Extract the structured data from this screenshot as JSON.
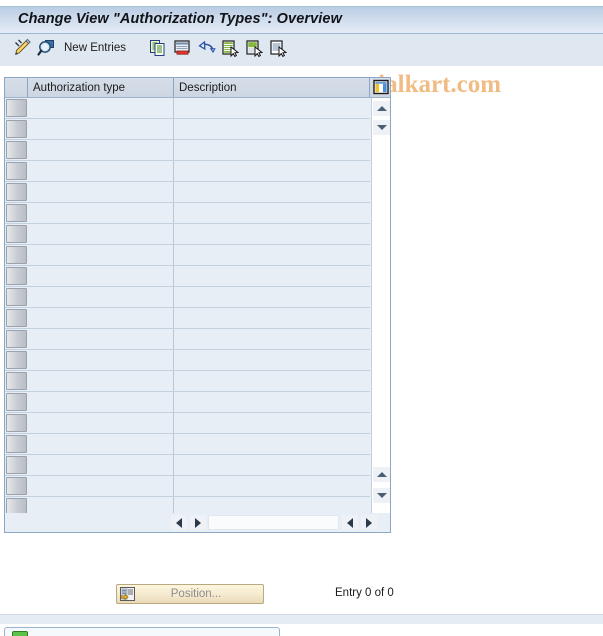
{
  "window": {
    "title": "Change View \"Authorization Types\": Overview"
  },
  "toolbar": {
    "items": [
      {
        "name": "display-change-icon",
        "label": "",
        "icon": "pencil-edit-icon"
      },
      {
        "name": "display-details-icon",
        "label": "",
        "icon": "magnifier-icon"
      },
      {
        "name": "new-entries-button",
        "label": "New Entries",
        "icon": ""
      },
      {
        "name": "copy-as-icon",
        "label": "",
        "icon": "copy-icon"
      },
      {
        "name": "delete-icon",
        "label": "",
        "icon": "delete-row-icon"
      },
      {
        "name": "undo-icon",
        "label": "",
        "icon": "undo-arrow-icon"
      },
      {
        "name": "select-all-icon",
        "label": "",
        "icon": "select-all-icon"
      },
      {
        "name": "select-block-icon",
        "label": "",
        "icon": "select-block-icon"
      },
      {
        "name": "deselect-all-icon",
        "label": "",
        "icon": "deselect-all-icon"
      }
    ],
    "new_entries_label": "New Entries"
  },
  "watermark": {
    "text": "www.tutorialkart.com",
    "color": "#f0bc84"
  },
  "table": {
    "columns": [
      {
        "key": "selector",
        "label": ""
      },
      {
        "key": "auth_type",
        "label": "Authorization type"
      },
      {
        "key": "description",
        "label": "Description"
      }
    ],
    "config_icon": "table-settings-icon",
    "rows": [
      {
        "auth_type": "",
        "description": ""
      },
      {
        "auth_type": "",
        "description": ""
      },
      {
        "auth_type": "",
        "description": ""
      },
      {
        "auth_type": "",
        "description": ""
      },
      {
        "auth_type": "",
        "description": ""
      },
      {
        "auth_type": "",
        "description": ""
      },
      {
        "auth_type": "",
        "description": ""
      },
      {
        "auth_type": "",
        "description": ""
      },
      {
        "auth_type": "",
        "description": ""
      },
      {
        "auth_type": "",
        "description": ""
      },
      {
        "auth_type": "",
        "description": ""
      },
      {
        "auth_type": "",
        "description": ""
      },
      {
        "auth_type": "",
        "description": ""
      },
      {
        "auth_type": "",
        "description": ""
      },
      {
        "auth_type": "",
        "description": ""
      },
      {
        "auth_type": "",
        "description": ""
      },
      {
        "auth_type": "",
        "description": ""
      },
      {
        "auth_type": "",
        "description": ""
      },
      {
        "auth_type": "",
        "description": ""
      },
      {
        "auth_type": "",
        "description": ""
      }
    ]
  },
  "scrollbars": {
    "vertical": {
      "top_up_label": "▲",
      "top_down_label": "▼",
      "bottom_up_label": "▲",
      "bottom_down_label": "▼"
    },
    "horizontal": {
      "left_label": "◀",
      "right_label": "▶"
    }
  },
  "footer": {
    "position_button_label": "Position...",
    "position_button_icon": "position-icon",
    "entry_count_text": "Entry 0 of 0"
  },
  "statusbar": {
    "icon": "status-ok-icon",
    "text": ""
  },
  "colors": {
    "title_bar_start": "#b9cde4",
    "title_bar_end": "#e3ecf6",
    "toolbar_bg": "#dfe7f0",
    "table_bg": "#e8eef6",
    "table_border": "#8ba7c6",
    "watermark": "#f0bc84",
    "position_button": "#f5ead0"
  }
}
